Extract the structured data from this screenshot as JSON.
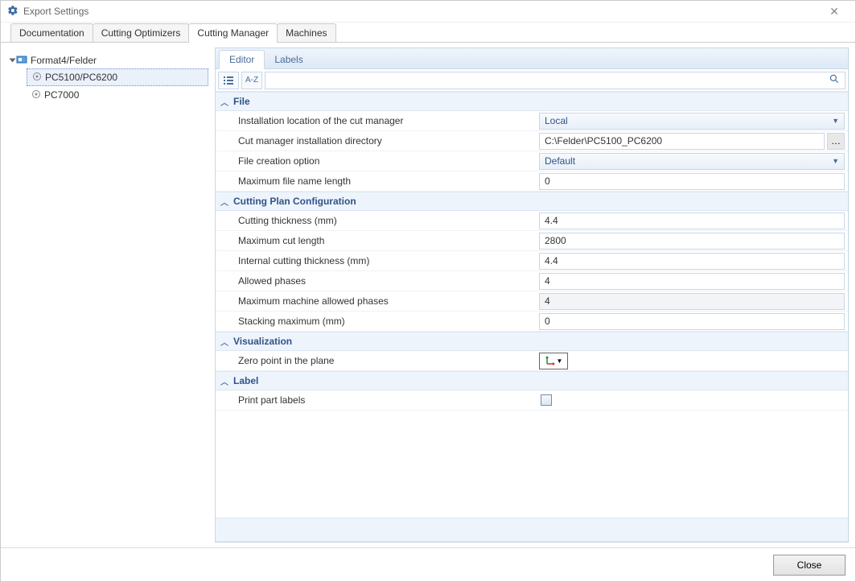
{
  "window": {
    "title": "Export Settings"
  },
  "tabs_main": [
    {
      "label": "Documentation"
    },
    {
      "label": "Cutting Optimizers"
    },
    {
      "label": "Cutting Manager"
    },
    {
      "label": "Machines"
    }
  ],
  "tree": {
    "root": {
      "label": "Format4/Felder"
    },
    "children": [
      {
        "label": "PC5100/PC6200"
      },
      {
        "label": "PC7000"
      }
    ]
  },
  "panel_tabs": [
    {
      "label": "Editor"
    },
    {
      "label": "Labels"
    }
  ],
  "toolbar": {
    "sort_label": "A-Z"
  },
  "groups": {
    "file": {
      "title": "File",
      "rows": {
        "install_location": {
          "label": "Installation location of the cut manager",
          "value": "Local"
        },
        "install_dir": {
          "label": "Cut manager installation directory",
          "value": "C:\\Felder\\PC5100_PC6200"
        },
        "file_creation": {
          "label": "File creation option",
          "value": "Default"
        },
        "max_filename": {
          "label": "Maximum file name length",
          "value": "0"
        }
      }
    },
    "cutting": {
      "title": "Cutting Plan Configuration",
      "rows": {
        "thickness": {
          "label": "Cutting thickness (mm)",
          "value": "4.4"
        },
        "max_cut_length": {
          "label": "Maximum cut length",
          "value": "2800"
        },
        "internal_thick": {
          "label": "Internal cutting thickness (mm)",
          "value": "4.4"
        },
        "allowed_phases": {
          "label": "Allowed phases",
          "value": "4"
        },
        "max_machine_phases": {
          "label": "Maximum machine allowed phases",
          "value": "4"
        },
        "stacking_max": {
          "label": "Stacking maximum (mm)",
          "value": "0"
        }
      }
    },
    "visual": {
      "title": "Visualization",
      "rows": {
        "zero_point": {
          "label": "Zero point in the plane"
        }
      }
    },
    "label": {
      "title": "Label",
      "rows": {
        "print_labels": {
          "label": "Print part labels"
        }
      }
    }
  },
  "footer": {
    "close": "Close"
  }
}
